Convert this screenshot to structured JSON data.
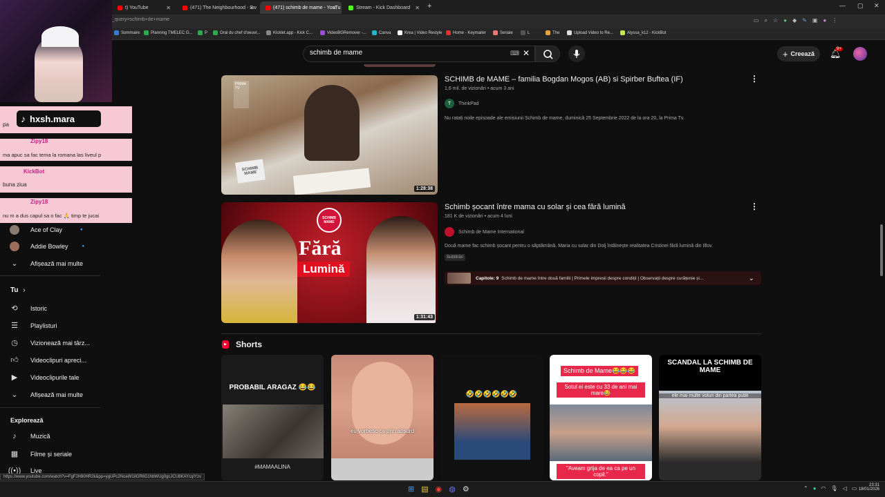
{
  "browser": {
    "tabs": [
      {
        "label": "t) YouTube",
        "color": "#ff0000"
      },
      {
        "label": "(471) The Neighbourhood - Sw",
        "color": "#ff0000"
      },
      {
        "label": "(471) schimb de mame - YouTu",
        "color": "#ff0000"
      },
      {
        "label": "Stream - Kick Dashboard",
        "color": "#53fc18"
      }
    ],
    "url": "_query=schimb+de+mame",
    "bookmarks": [
      "Sommaire",
      "Planning TMELEC G...",
      "P",
      "Oral du chef d'oeuvr...",
      "Kicklet.app - Kick C...",
      "VideoBGRemover -...",
      "Canva",
      "Krea | Video Restyle",
      "Home - Keymailer",
      "Seriale",
      "L",
      "The",
      "Upload Video to Re...",
      "Alyssa_k12 - KickBot"
    ]
  },
  "header": {
    "search_value": "schimb de mame",
    "create_label": "Creează",
    "notif_badge": "9+"
  },
  "sidebar": {
    "subscriptions": [
      {
        "name": "Ace of Clay"
      },
      {
        "name": "Addie Bowley"
      }
    ],
    "show_more_1": "Afișează mai multe",
    "you_heading": "Tu",
    "you_items": [
      {
        "label": "Istoric",
        "icon": "history-icon"
      },
      {
        "label": "Playlisturi",
        "icon": "playlist-icon"
      },
      {
        "label": "Vizionează mai târz...",
        "icon": "watch-later-icon"
      },
      {
        "label": "Videoclipuri apreci...",
        "icon": "like-icon"
      },
      {
        "label": "Videoclipurile tale",
        "icon": "your-videos-icon"
      }
    ],
    "show_more_2": "Afișează mai multe",
    "explore_heading": "Explorează",
    "explore_items": [
      {
        "label": "Muzică",
        "icon": "music-icon"
      },
      {
        "label": "Filme și seriale",
        "icon": "movies-icon"
      },
      {
        "label": "Live",
        "icon": "live-icon"
      }
    ]
  },
  "results": [
    {
      "title": "SCHIMB de MAME – familia Bogdan Mogos (AB) si Spirber Buftea (IF)",
      "views": "1,6 mil. de vizionări",
      "age": "acum 3 ani",
      "channel": "ThinkPad",
      "channel_initial": "T",
      "description": "Nu ratați noile episoade ale emisiunii Schimb de mame, duminică 25 Septembrie 2022 de la ora 20, la Prima Tv.",
      "duration": "1:28:38",
      "thumb_label": "SCHIMB MAME"
    },
    {
      "title": "Schimb șocant între mama cu solar și cea fără lumină",
      "views": "181 K de vizionări",
      "age": "acum 4 luni",
      "channel": "Schimb de Mame International",
      "description": "Două mame fac schimb șocant pentru o săptămână. Maria cu solar din Dolj întâlnește realitatea Cristinei fără lumină din Ilfov.",
      "badge": "Subtitrări",
      "chapters_label": "Capitole: 9",
      "chapters_text": "Schimb de mame între două familii | Primele impresii despre condiții | Observații despre curățenie și...",
      "duration": "1:31:43",
      "thumb_big": "Fără",
      "thumb_red": "Lumină",
      "thumb_logo": "SCHIMB MAME"
    }
  ],
  "shorts": {
    "heading": "Shorts",
    "items": [
      {
        "caption_top": "PROBABIL ARAGAZ 😂😂",
        "caption_bottom": "#MAMAALINA"
      },
      {
        "caption_mid": "eu vorbesc ca prin absurd"
      },
      {
        "caption_mid": "🤣🤣🤣🤣🤣🤣"
      },
      {
        "caption_top": "Schimb de Mame😂😂😂",
        "caption_2": "Sotul ei este cu 33 de ani mai mare😂",
        "caption_bottom": "\"Aveam grija de ea ca pe un copil.\""
      },
      {
        "caption_top": "SCANDAL LA SCHIMB DE MAME",
        "caption_2": "ele mai multe voturi din partea publi"
      }
    ]
  },
  "status_url": "https://www.youtube.com/watch?v=FgFJH80HR2k&pp=ygUPc2NoaW1iIGRlIG1hbWUg0gcJCU8KAYcqIYzv",
  "taskbar": {
    "time": "23:31",
    "date": "18/01/2026"
  },
  "overlay": {
    "handle": "hxsh.mara",
    "chat": [
      {
        "user": "",
        "text": "pa"
      },
      {
        "user": "Zipy18",
        "text": "ma apuc sa fac tema la romana las liveul p"
      },
      {
        "user": "KickBot",
        "text": "buna ziua"
      },
      {
        "user": "Zipy18",
        "text": "nu m a dus capul sa o fac 🙏 timp te jucai"
      }
    ]
  }
}
